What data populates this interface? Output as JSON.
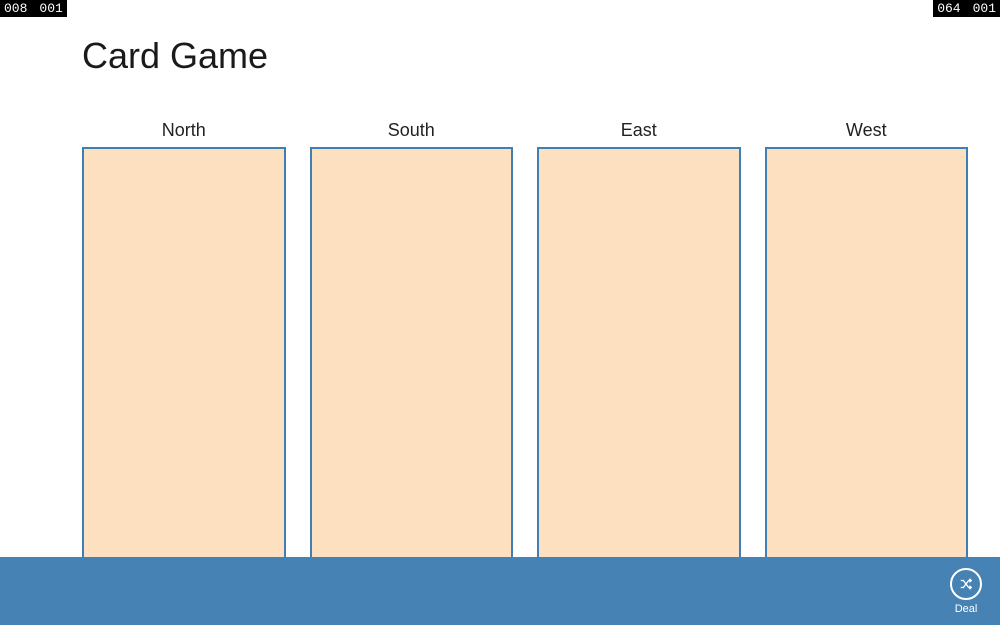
{
  "counters": {
    "left": {
      "a": "008",
      "b": "001"
    },
    "right": {
      "a": "064",
      "b": "001"
    }
  },
  "title": "Card Game",
  "stacks": [
    {
      "label": "North"
    },
    {
      "label": "South"
    },
    {
      "label": "East"
    },
    {
      "label": "West"
    }
  ],
  "appbar": {
    "deal_label": "Deal"
  },
  "colors": {
    "accent": "#4682b4",
    "slot_fill": "#fce0bf",
    "slot_border": "#3f7fb5"
  }
}
